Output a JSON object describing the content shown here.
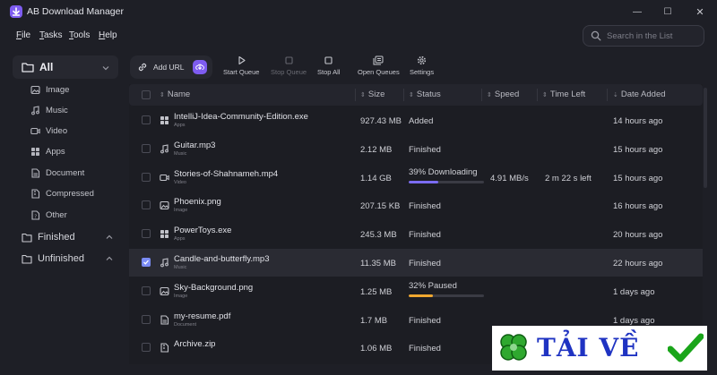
{
  "app": {
    "title": "AB Download Manager"
  },
  "window_controls": {
    "minimize": "—",
    "maximize": "☐",
    "close": "✕"
  },
  "menu": [
    {
      "label": "File",
      "mnemonic": "F",
      "rest": "ile"
    },
    {
      "label": "Tasks",
      "mnemonic": "T",
      "rest": "asks"
    },
    {
      "label": "Tools",
      "mnemonic": "T",
      "rest": "ools"
    },
    {
      "label": "Help",
      "mnemonic": "H",
      "rest": "elp"
    }
  ],
  "search": {
    "placeholder": "Search in the List"
  },
  "sidebar": {
    "all": "All",
    "categories": [
      "Image",
      "Music",
      "Video",
      "Apps",
      "Document",
      "Compressed",
      "Other"
    ],
    "finished": "Finished",
    "unfinished": "Unfinished"
  },
  "toolbar": {
    "add_url": "Add URL",
    "start_queue": "Start Queue",
    "stop_queue": "Stop Queue",
    "stop_all": "Stop All",
    "open_queues": "Open Queues",
    "settings": "Settings"
  },
  "columns": {
    "name": "Name",
    "size": "Size",
    "status": "Status",
    "speed": "Speed",
    "time_left": "Time Left",
    "date_added": "Date Added"
  },
  "colors": {
    "accent": "#7e5cf0",
    "progress_downloading": "#7b6cf2",
    "progress_paused": "#f0a830",
    "checkbox": "#7b8cf5"
  },
  "rows": [
    {
      "name": "IntelliJ-Idea-Community-Edition.exe",
      "type": "Apps",
      "icon": "apps-icon",
      "size": "927.43 MB",
      "status": "Added",
      "speed": "",
      "time_left": "",
      "date": "14 hours ago",
      "progress": null,
      "selected": false
    },
    {
      "name": "Guitar.mp3",
      "type": "Music",
      "icon": "music-icon",
      "size": "2.12 MB",
      "status": "Finished",
      "speed": "",
      "time_left": "",
      "date": "15 hours ago",
      "progress": null,
      "selected": false
    },
    {
      "name": "Stories-of-Shahnameh.mp4",
      "type": "Video",
      "icon": "video-icon",
      "size": "1.14 GB",
      "status": "39% Downloading",
      "speed": "4.91 MB/s",
      "time_left": "2 m 22 s left",
      "date": "15 hours ago",
      "progress": 0.39,
      "progress_kind": "downloading",
      "selected": false
    },
    {
      "name": "Phoenix.png",
      "type": "Image",
      "icon": "image-icon",
      "size": "207.15 KB",
      "status": "Finished",
      "speed": "",
      "time_left": "",
      "date": "16 hours ago",
      "progress": null,
      "selected": false
    },
    {
      "name": "PowerToys.exe",
      "type": "Apps",
      "icon": "apps-icon",
      "size": "245.3 MB",
      "status": "Finished",
      "speed": "",
      "time_left": "",
      "date": "20 hours ago",
      "progress": null,
      "selected": false
    },
    {
      "name": "Candle-and-butterfly.mp3",
      "type": "Music",
      "icon": "music-icon",
      "size": "11.35 MB",
      "status": "Finished",
      "speed": "",
      "time_left": "",
      "date": "22 hours ago",
      "progress": null,
      "selected": true
    },
    {
      "name": "Sky-Background.png",
      "type": "Image",
      "icon": "image-icon",
      "size": "1.25 MB",
      "status": "32% Paused",
      "speed": "",
      "time_left": "",
      "date": "1 days ago",
      "progress": 0.32,
      "progress_kind": "paused",
      "selected": false
    },
    {
      "name": "my-resume.pdf",
      "type": "Document",
      "icon": "document-icon",
      "size": "1.7 MB",
      "status": "Finished",
      "speed": "",
      "time_left": "",
      "date": "1 days ago",
      "progress": null,
      "selected": false
    },
    {
      "name": "Archive.zip",
      "type": "",
      "icon": "compressed-icon",
      "size": "1.06 MB",
      "status": "Finished",
      "speed": "",
      "time_left": "",
      "date": "",
      "progress": null,
      "selected": false
    }
  ],
  "watermark": {
    "text": "TẢI VỀ"
  }
}
